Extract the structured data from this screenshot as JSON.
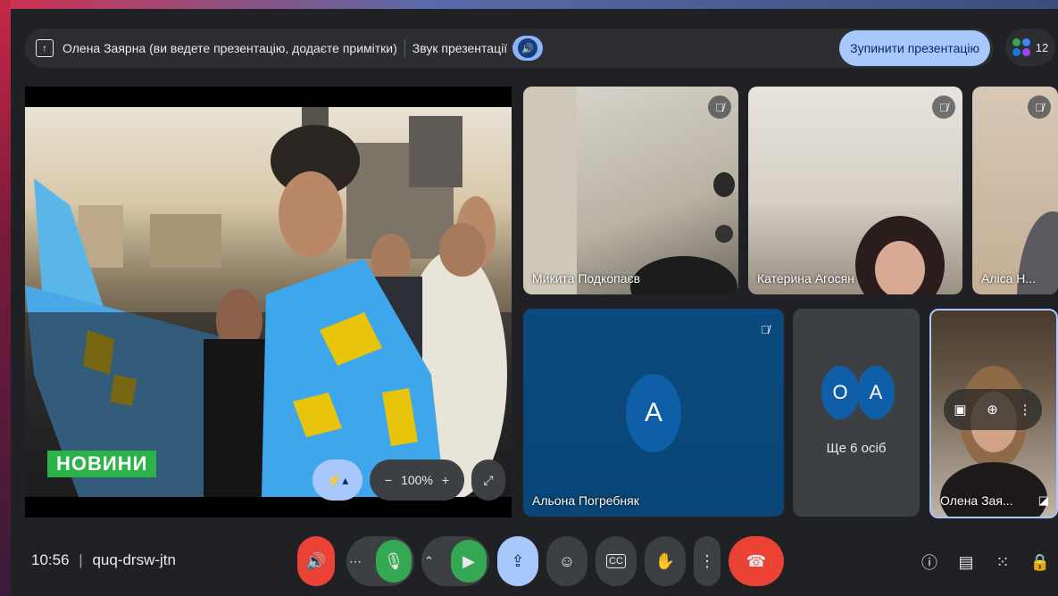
{
  "topbar": {
    "presenter_text": "Олена Заярна (ви ведете презентацію, додаєте примітки)",
    "audio_label": "Звук презентації",
    "stop_button": "Зупинити презентацію",
    "participant_count": "12"
  },
  "presentation": {
    "news_badge": "НОВИНИ",
    "zoom_level": "100%"
  },
  "tiles": [
    {
      "name": "Микита Подкопаєв",
      "muted": true
    },
    {
      "name": "Катерина Агосян",
      "muted": true
    },
    {
      "name": "Аліса Н...",
      "muted": true
    },
    {
      "name": "Альона Погребняк",
      "initial": "А",
      "muted": true
    },
    {
      "name": "Олена Зая...",
      "muted": false
    }
  ],
  "others": {
    "initials": [
      "О",
      "А"
    ],
    "label": "Ще 6 осіб"
  },
  "bottombar": {
    "time": "10:56",
    "meeting_code": "quq-drsw-jtn"
  },
  "colors": {
    "accent": "#a8c7fa",
    "end_call": "#ea4335",
    "mic_on": "#34a853"
  }
}
